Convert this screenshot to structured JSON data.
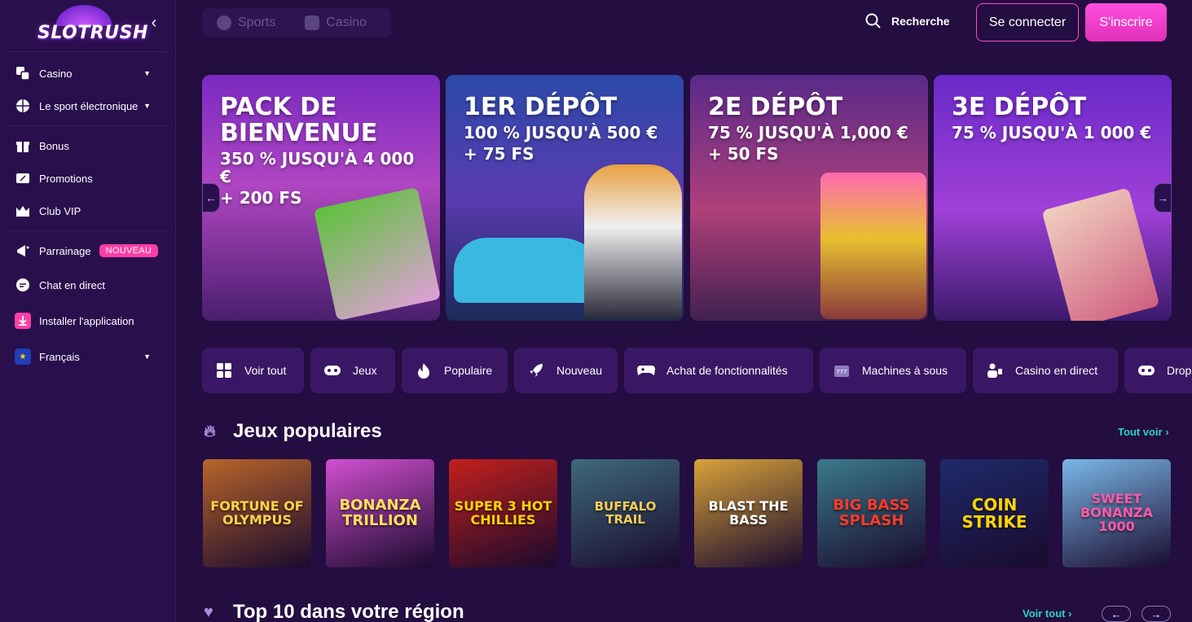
{
  "brand": {
    "logo_text": "SLOTRUSH"
  },
  "sidebar": {
    "collapse_icon": "chevron-left-icon",
    "items": [
      {
        "label": "Casino",
        "icon": "dice-icon"
      },
      {
        "label": "Le sport électronique",
        "icon": "ball-icon"
      },
      {
        "label": "Bonus",
        "icon": "gift-icon"
      },
      {
        "label": "Promotions",
        "icon": "ticket-icon"
      },
      {
        "label": "Club VIP",
        "icon": "crown-icon"
      },
      {
        "label": "Parrainage",
        "icon": "megaphone-icon",
        "badge": "NOUVEAU"
      },
      {
        "label": "Chat en direct",
        "icon": "chat-icon"
      },
      {
        "label": "Installer l'application",
        "icon": "download-icon"
      },
      {
        "label": "Français",
        "icon": "eu-flag-icon"
      }
    ]
  },
  "topbar": {
    "tabs": [
      {
        "label": "Sports"
      },
      {
        "label": "Casino"
      }
    ],
    "search_label": "Recherche",
    "login_label": "Se connecter",
    "signup_label": "S'inscrire"
  },
  "banners": [
    {
      "title": "PACK DE BIENVENUE",
      "subtitle": "350 % JUSQU'À 4 000 €",
      "extra": "+ 200 FS"
    },
    {
      "title": "1ER DÉPÔT",
      "subtitle": "100 % JUSQU'À 500 €",
      "extra": "+ 75 FS"
    },
    {
      "title": "2E DÉPÔT",
      "subtitle": "75 % JUSQU'À 1,000 €",
      "extra": "+ 50 FS"
    },
    {
      "title": "3E DÉPÔT",
      "subtitle": "75 % JUSQU'À 1 000 €",
      "extra": ""
    }
  ],
  "banner_nav": {
    "prev": "←",
    "next": "→"
  },
  "categories": [
    {
      "label": "Voir tout",
      "icon": "grid-icon"
    },
    {
      "label": "Jeux",
      "icon": "gamepad-icon"
    },
    {
      "label": "Populaire",
      "icon": "flame-icon"
    },
    {
      "label": "Nouveau",
      "icon": "rocket-icon"
    },
    {
      "label": "Achat de fonctionnalités",
      "icon": "controller-icon"
    },
    {
      "label": "Machines à sous",
      "icon": "slot-machine-icon"
    },
    {
      "label": "Casino en direct",
      "icon": "dealer-icon"
    },
    {
      "label": "Drop",
      "icon": "gamepad-icon"
    }
  ],
  "popular": {
    "title": "Jeux populaires",
    "see_all": "Tout voir ›",
    "games": [
      {
        "name": "FORTUNE OF OLYMPUS",
        "bg": "#b8642a",
        "fg": "#ffd34a"
      },
      {
        "name": "BONANZA TRILLION",
        "bg": "#d24fd0",
        "fg": "#ffe15a"
      },
      {
        "name": "SUPER 3 HOT CHILLIES",
        "bg": "#c2201c",
        "fg": "#ffd400"
      },
      {
        "name": "BUFFALO TRAIL",
        "bg": "#3e6a78",
        "fg": "#ffcc55"
      },
      {
        "name": "BLAST THE BASS",
        "bg": "#d8a23a",
        "fg": "#ffffff"
      },
      {
        "name": "BIG BASS SPLASH",
        "bg": "#3a7a8a",
        "fg": "#ff3a2a"
      },
      {
        "name": "COIN STRIKE",
        "bg": "#1e2a6a",
        "fg": "#ffd400"
      },
      {
        "name": "SWEET BONANZA 1000",
        "bg": "#7ab8e8",
        "fg": "#ff5aa8"
      }
    ]
  },
  "top10": {
    "title": "Top 10 dans votre région",
    "see_all": "Voir tout ›",
    "prev": "←",
    "next": "→"
  }
}
